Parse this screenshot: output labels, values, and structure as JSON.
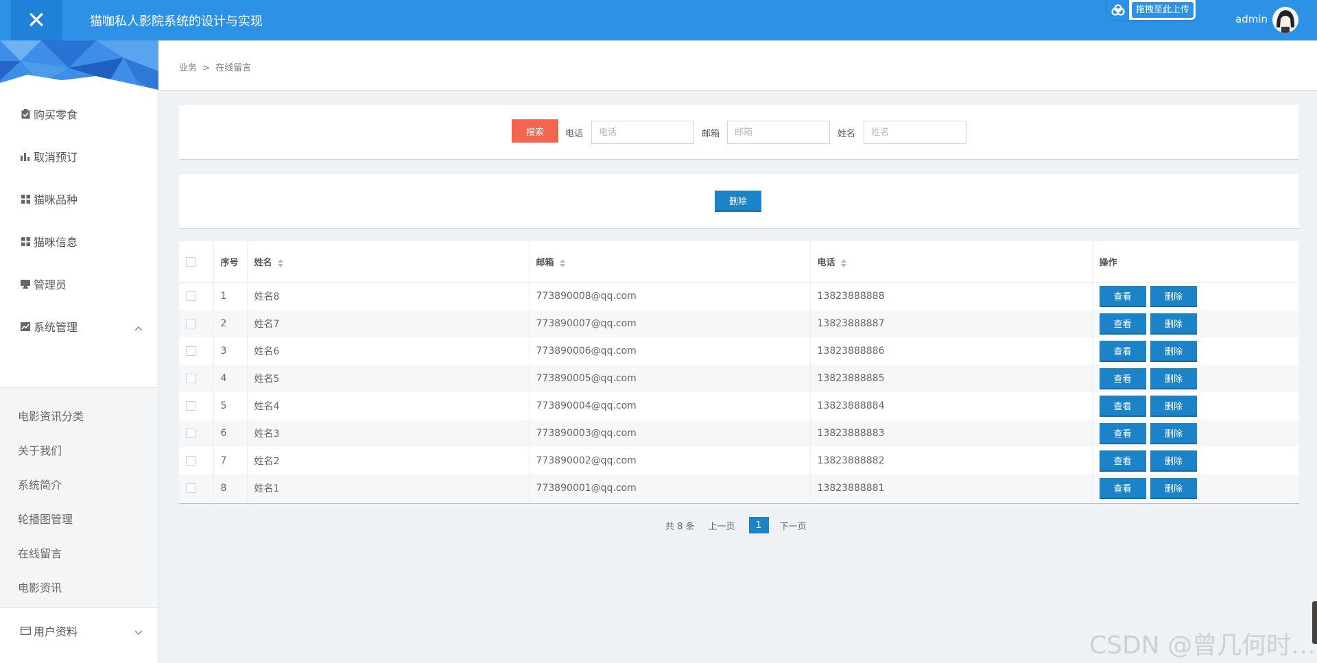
{
  "header": {
    "title": "猫咖私人影院系统的设计与实现",
    "upload_label": "拖拽至此上传",
    "user": "admin",
    "accent": "#2d92e6"
  },
  "sidebar": {
    "items": [
      {
        "label": "购买零食",
        "icon": "clipboard-check-icon"
      },
      {
        "label": "取消预订",
        "icon": "bar-chart-icon"
      },
      {
        "label": "猫咪品种",
        "icon": "grid-icon"
      },
      {
        "label": "猫咪信息",
        "icon": "grid-icon"
      },
      {
        "label": "管理员",
        "icon": "monitor-icon"
      },
      {
        "label": "系统管理",
        "icon": "line-chart-icon",
        "expanded": true
      },
      {
        "label": "用户资料",
        "icon": "id-card-icon",
        "expanded": false
      }
    ],
    "submenu": [
      "电影资讯分类",
      "关于我们",
      "系统简介",
      "轮播图管理",
      "在线留言",
      "电影资讯"
    ]
  },
  "breadcrumb": {
    "parent": "业务",
    "separator": ">",
    "current": "在线留言"
  },
  "search": {
    "button": "搜索",
    "fields": [
      {
        "label": "电话",
        "placeholder": "电话"
      },
      {
        "label": "邮箱",
        "placeholder": "邮箱"
      },
      {
        "label": "姓名",
        "placeholder": "姓名"
      }
    ]
  },
  "actions": {
    "bulk_delete": "删除"
  },
  "table": {
    "columns": [
      "序号",
      "姓名",
      "邮箱",
      "电话",
      "操作"
    ],
    "view_label": "查看",
    "delete_label": "删除",
    "rows": [
      {
        "index": "1",
        "name": "姓名8",
        "email": "773890008@qq.com",
        "phone": "13823888888"
      },
      {
        "index": "2",
        "name": "姓名7",
        "email": "773890007@qq.com",
        "phone": "13823888887"
      },
      {
        "index": "3",
        "name": "姓名6",
        "email": "773890006@qq.com",
        "phone": "13823888886"
      },
      {
        "index": "4",
        "name": "姓名5",
        "email": "773890005@qq.com",
        "phone": "13823888885"
      },
      {
        "index": "5",
        "name": "姓名4",
        "email": "773890004@qq.com",
        "phone": "13823888884"
      },
      {
        "index": "6",
        "name": "姓名3",
        "email": "773890003@qq.com",
        "phone": "13823888883"
      },
      {
        "index": "7",
        "name": "姓名2",
        "email": "773890002@qq.com",
        "phone": "13823888882"
      },
      {
        "index": "8",
        "name": "姓名1",
        "email": "773890001@qq.com",
        "phone": "13823888881"
      }
    ]
  },
  "pagination": {
    "total": "共 8 条",
    "prev": "上一页",
    "current": "1",
    "next": "下一页"
  },
  "watermark": "CSDN @曾几何时…"
}
